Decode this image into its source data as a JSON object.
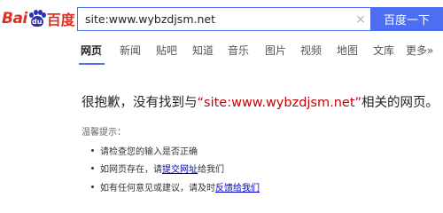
{
  "logo": {
    "text_left": "Bai",
    "paw_text": "du",
    "text_right": "百度"
  },
  "search": {
    "value": "site:www.wybzdjsm.net",
    "clear_icon": "×",
    "button_label": "百度一下"
  },
  "tabs": [
    {
      "label": "网页"
    },
    {
      "label": "新闻"
    },
    {
      "label": "贴吧"
    },
    {
      "label": "知道"
    },
    {
      "label": "音乐"
    },
    {
      "label": "图片"
    },
    {
      "label": "视频"
    },
    {
      "label": "地图"
    },
    {
      "label": "文库"
    },
    {
      "label": "更多»"
    }
  ],
  "result": {
    "prefix": "很抱歉，没有找到与",
    "query": "“site:www.wybzdjsm.net”",
    "suffix": "相关的网页。"
  },
  "tips": {
    "title": "温馨提示：",
    "item1": "请检查您的输入是否正确",
    "item2_prefix": "如网页存在，请",
    "item2_link": "提交网址",
    "item2_suffix": "给我们",
    "item3_prefix": "如有任何意见或建议，请及时",
    "item3_link": "反馈给我们"
  },
  "colors": {
    "brand_blue": "#4e6ef2",
    "logo_red": "#de2f24",
    "query_red": "#cc0000",
    "link_blue": "#0000cc"
  }
}
